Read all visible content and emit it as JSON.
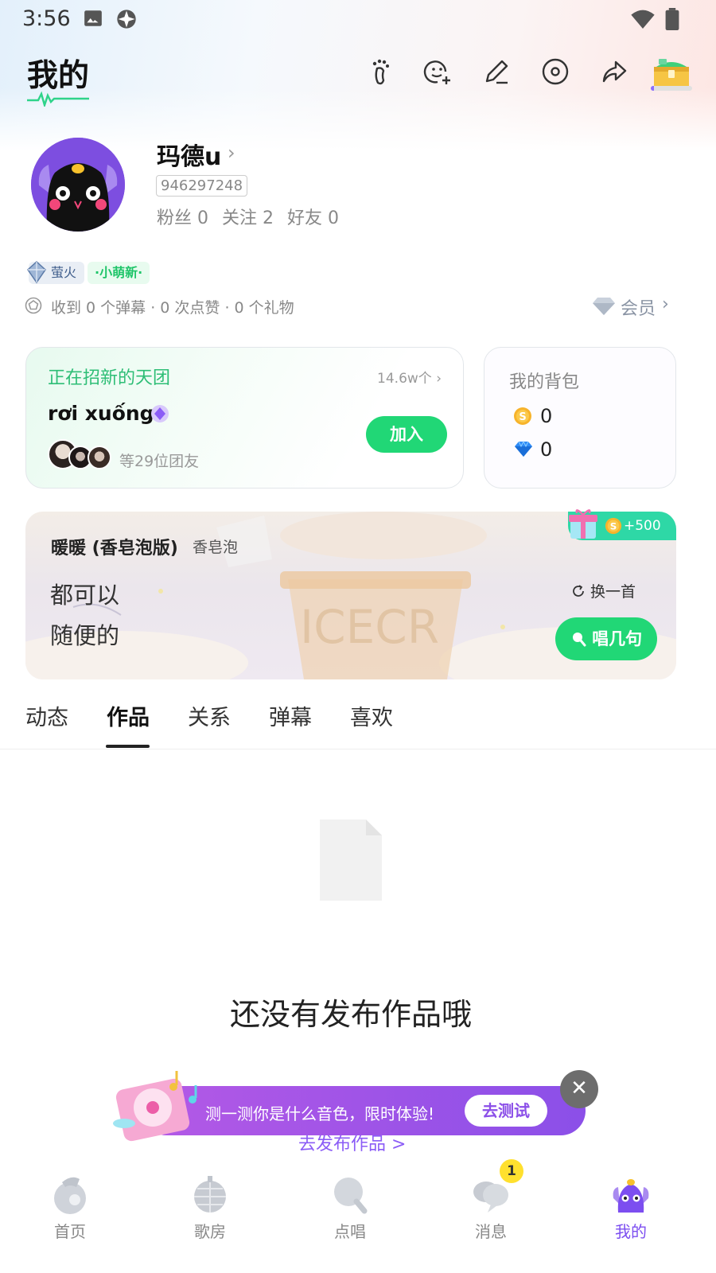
{
  "status_bar": {
    "time": "3:56"
  },
  "header": {
    "title": "我的"
  },
  "profile": {
    "username": "玛德u",
    "user_id": "946297248",
    "fans": "粉丝 0",
    "following": "关注 2",
    "friends": "好友 0",
    "badge_level": "萤火",
    "badge_new": "·小萌新·",
    "received_summary": "收到 0 个弹幕 · 0 次点赞 · 0 个礼物",
    "vip_label": "会员"
  },
  "group_card": {
    "title": "正在招新的天团",
    "count": "14.6w个",
    "name": "rơi xuống",
    "members_text": "等29位团友",
    "join_label": "加入"
  },
  "bag_card": {
    "title": "我的背包",
    "coins": "0",
    "diamonds": "0"
  },
  "song_card": {
    "title": "暖暖 (香皂泡版)",
    "artist": "香皂泡",
    "lyric_line_1": "都可以",
    "lyric_line_2": "随便的",
    "switch_label": "换一首",
    "sing_label": "唱几句",
    "reward": "+500"
  },
  "tabs": [
    {
      "label": "动态"
    },
    {
      "label": "作品"
    },
    {
      "label": "关系"
    },
    {
      "label": "弹幕"
    },
    {
      "label": "喜欢"
    }
  ],
  "empty_state": {
    "message": "还没有发布作品哦",
    "publish_link": "去发布作品 >"
  },
  "promo_banner": {
    "text": "测一测你是什么音色，限时体验!",
    "button": "去测试"
  },
  "bottom_nav": [
    {
      "label": "首页"
    },
    {
      "label": "歌房"
    },
    {
      "label": "点唱"
    },
    {
      "label": "消息",
      "badge": "1"
    },
    {
      "label": "我的"
    }
  ],
  "colors": {
    "accent_green": "#21d776",
    "accent_purple": "#7c4ef0"
  }
}
